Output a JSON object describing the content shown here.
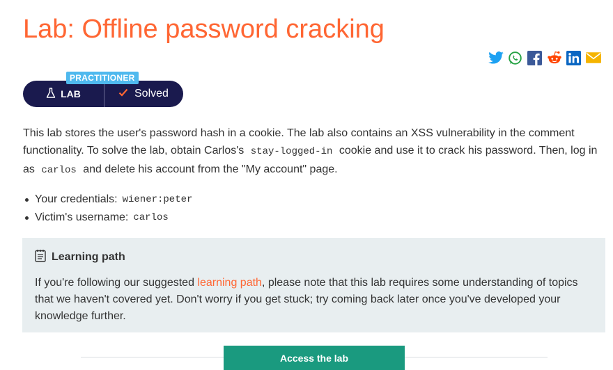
{
  "page": {
    "title": "Lab: Offline password cracking"
  },
  "share": [
    "twitter-icon",
    "whatsapp-icon",
    "facebook-icon",
    "reddit-icon",
    "linkedin-icon",
    "email-icon"
  ],
  "badge": {
    "level": "PRACTITIONER",
    "type_label": "LAB",
    "status_label": "Solved"
  },
  "description": {
    "part1": "This lab stores the user's password hash in a cookie. The lab also contains an XSS vulnerability in the comment functionality. To solve the lab, obtain Carlos's",
    "code1": "stay-logged-in",
    "part2": "cookie and use it to crack his password. Then, log in as",
    "code2": "carlos",
    "part3": "and delete his account from the \"My account\" page."
  },
  "facts": [
    {
      "label": "Your credentials:",
      "value": "wiener:peter"
    },
    {
      "label": "Victim's username:",
      "value": "carlos"
    }
  ],
  "learning_path": {
    "heading": "Learning path",
    "text_before": "If you're following our suggested",
    "link": "learning path",
    "text_after": ", please note that this lab requires some understanding of topics that we haven't covered yet. Don't worry if you get stuck; try coming back later once you've developed your knowledge further."
  },
  "cta": {
    "label": "Access the lab"
  },
  "colors": {
    "title": "#ff6633",
    "pill": "#1a1a4e",
    "badge": "#4fb9ee",
    "check": "#ff6633",
    "box": "#e8eef0",
    "button": "#1a9a7f"
  }
}
